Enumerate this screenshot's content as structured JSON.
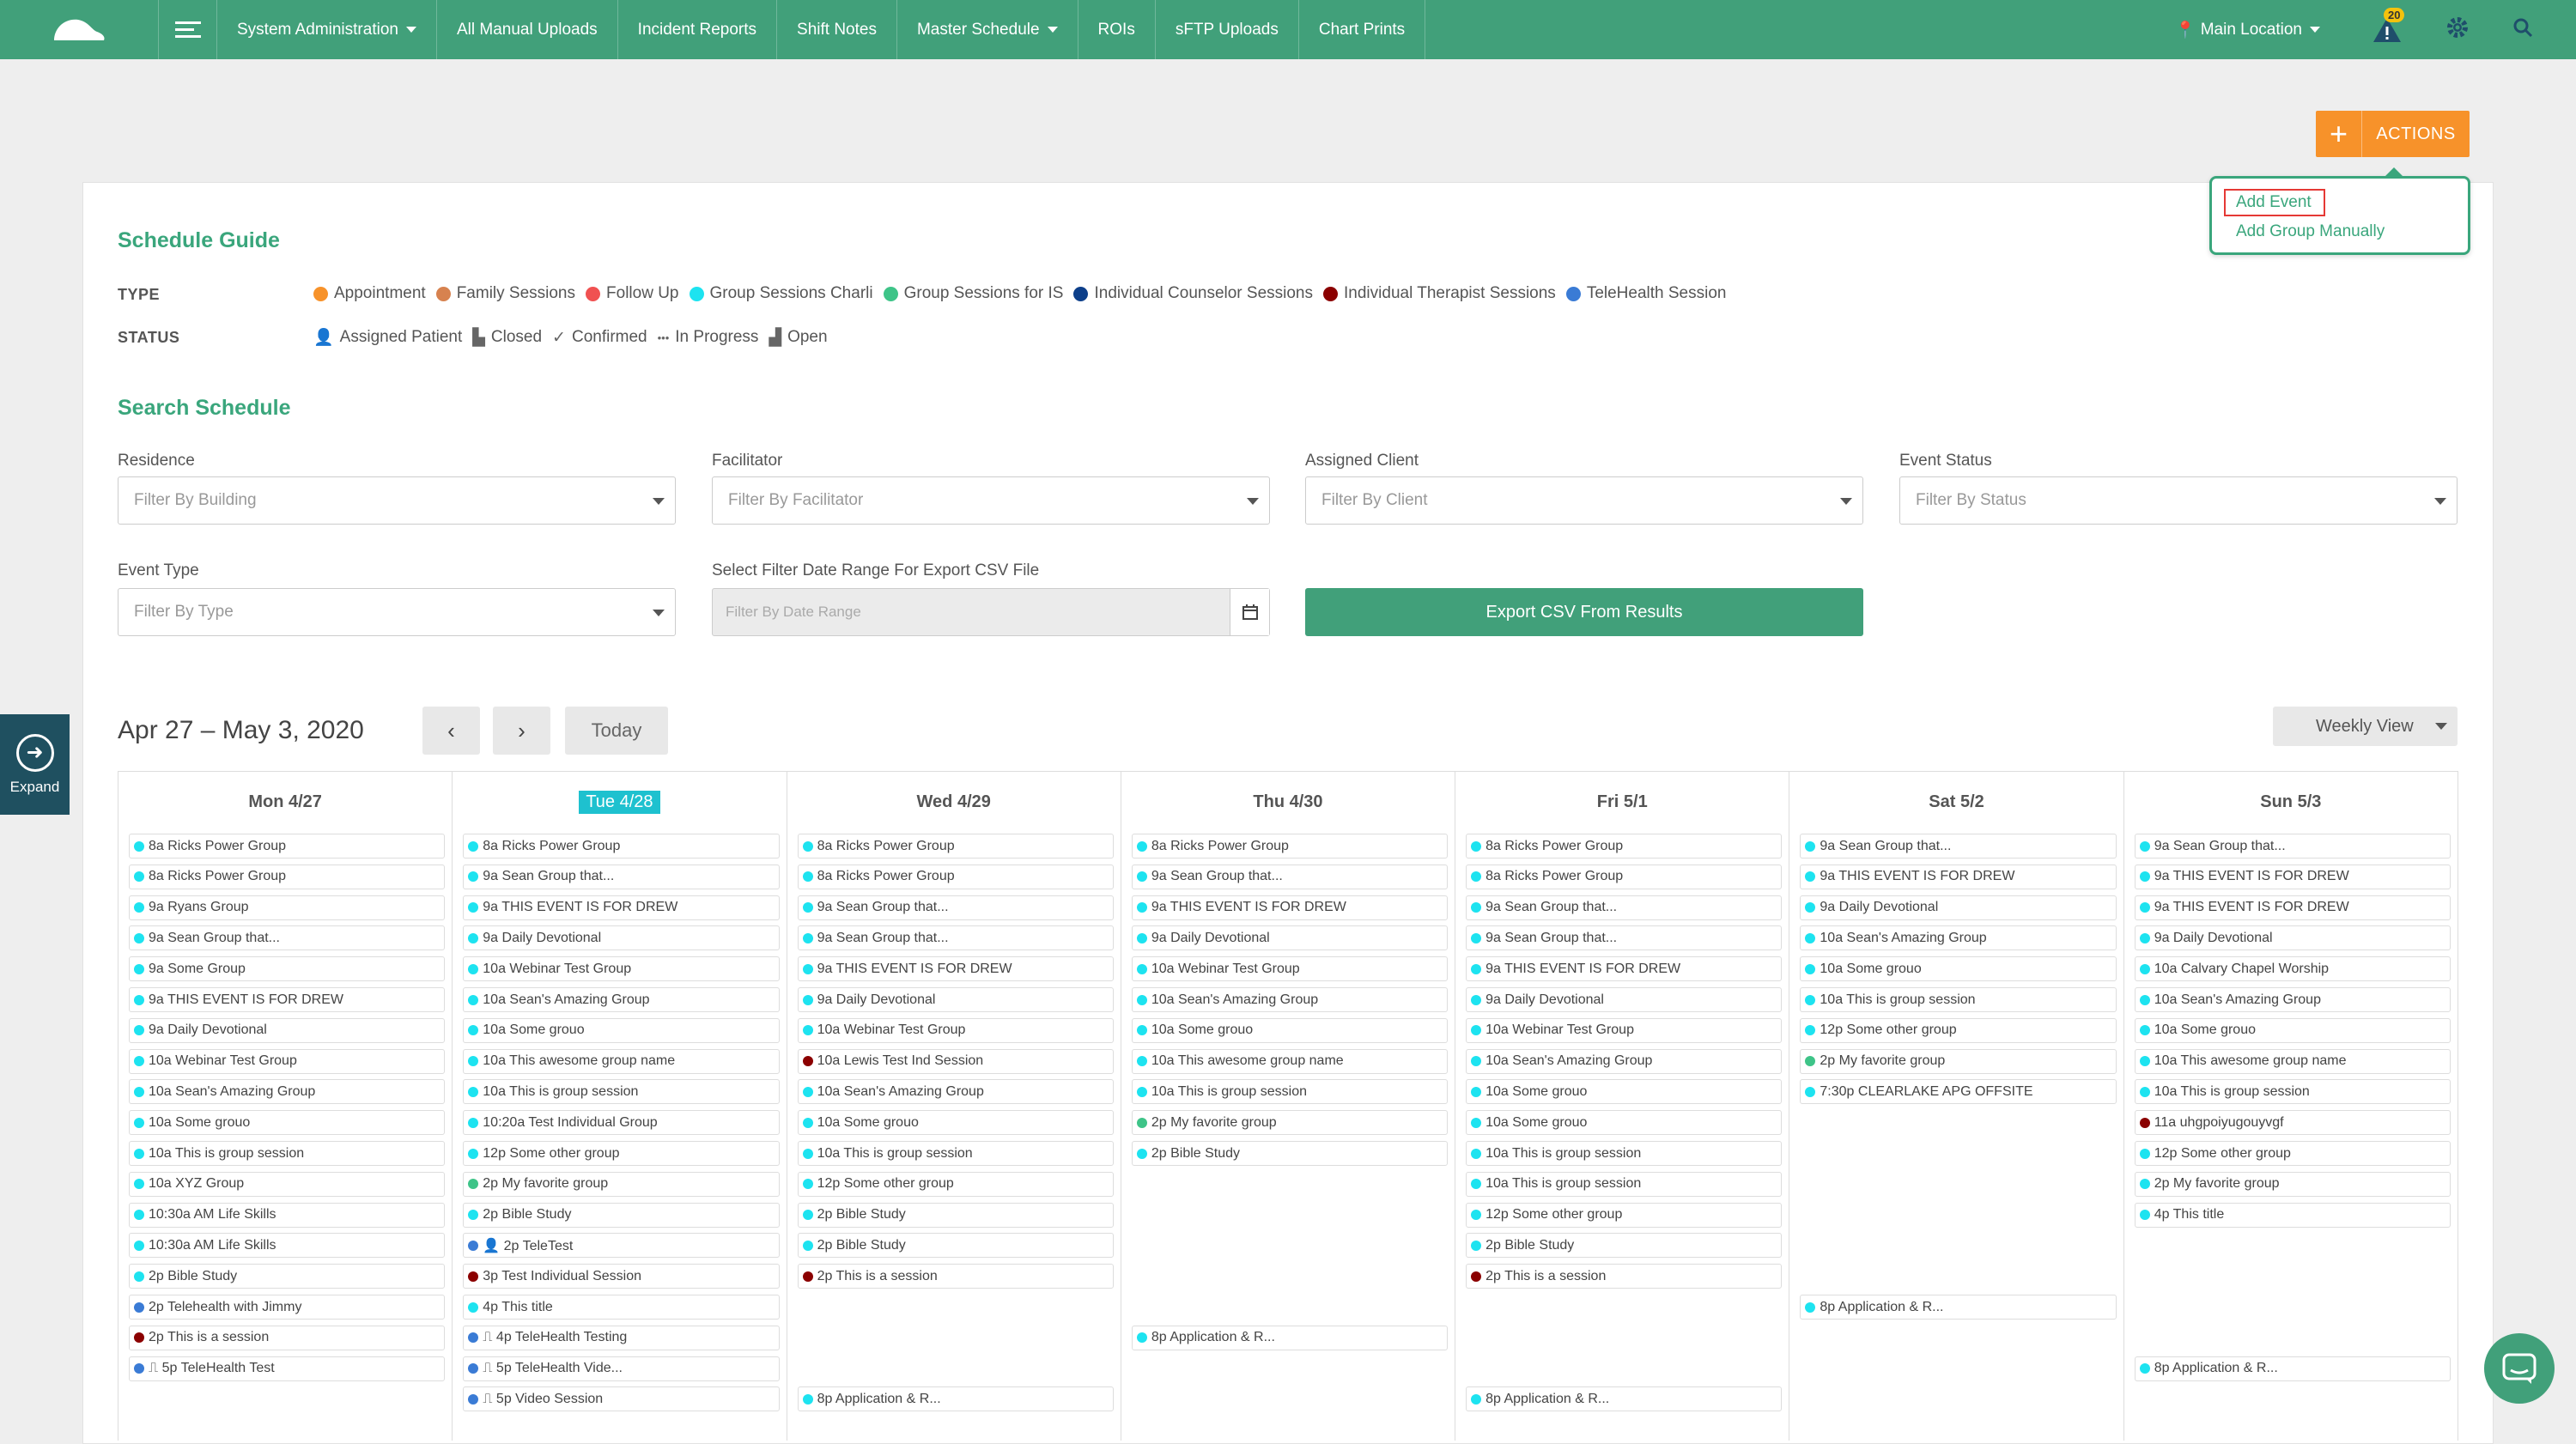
{
  "nav": {
    "items": [
      "System Administration",
      "All Manual Uploads",
      "Incident Reports",
      "Shift Notes",
      "Master Schedule",
      "ROIs",
      "sFTP Uploads",
      "Chart Prints"
    ],
    "dropdown_items": [
      0,
      4
    ],
    "location": "Main Location",
    "notification_count": "20"
  },
  "actions": {
    "label": "ACTIONS",
    "menu": [
      "Add Event",
      "Add Group Manually"
    ]
  },
  "guide": {
    "title": "Schedule Guide",
    "type_label": "TYPE",
    "status_label": "STATUS",
    "types": [
      {
        "name": "Appointment",
        "color": "#f7922a"
      },
      {
        "name": "Family Sessions",
        "color": "#d7824f"
      },
      {
        "name": "Follow Up",
        "color": "#f05151"
      },
      {
        "name": "Group Sessions Charli",
        "color": "#1de3f0"
      },
      {
        "name": "Group Sessions for IS",
        "color": "#3ec488"
      },
      {
        "name": "Individual Counselor Sessions",
        "color": "#0d3f8a"
      },
      {
        "name": "Individual Therapist Sessions",
        "color": "#8b0000"
      },
      {
        "name": "TeleHealth Session",
        "color": "#3a7bd5"
      }
    ],
    "statuses": [
      {
        "name": "Assigned Patient",
        "icon": "user-icon"
      },
      {
        "name": "Closed",
        "icon": "closed-icon"
      },
      {
        "name": "Confirmed",
        "icon": "check-icon"
      },
      {
        "name": "In Progress",
        "icon": "ellipsis-icon"
      },
      {
        "name": "Open",
        "icon": "open-icon"
      }
    ]
  },
  "search": {
    "title": "Search Schedule",
    "residence_label": "Residence",
    "residence_placeholder": "Filter By Building",
    "facilitator_label": "Facilitator",
    "facilitator_placeholder": "Filter By Facilitator",
    "client_label": "Assigned Client",
    "client_placeholder": "Filter By Client",
    "status_label": "Event Status",
    "status_placeholder": "Filter By Status",
    "type_label": "Event Type",
    "type_placeholder": "Filter By Type",
    "range_label": "Select Filter Date Range For Export CSV File",
    "range_placeholder": "Filter By Date Range",
    "export_label": "Export CSV From Results"
  },
  "calendar": {
    "range": "Apr 27 – May 3, 2020",
    "prev": "‹",
    "next": "›",
    "today": "Today",
    "view": "Weekly View",
    "expand": "Expand",
    "days": [
      {
        "label": "Mon 4/27",
        "today": false,
        "events": [
          {
            "t": "8a Ricks Power Group",
            "c": "#1de3f0"
          },
          {
            "t": "8a Ricks Power Group",
            "c": "#1de3f0"
          },
          {
            "t": "9a Ryans Group",
            "c": "#1de3f0"
          },
          {
            "t": "9a Sean Group that...",
            "c": "#1de3f0"
          },
          {
            "t": "9a Some Group",
            "c": "#1de3f0"
          },
          {
            "t": "9a THIS EVENT IS FOR DREW",
            "c": "#1de3f0"
          },
          {
            "t": "9a Daily Devotional",
            "c": "#1de3f0"
          },
          {
            "t": "10a Webinar Test Group",
            "c": "#1de3f0"
          },
          {
            "t": "10a Sean's Amazing Group",
            "c": "#1de3f0"
          },
          {
            "t": "10a Some grouo",
            "c": "#1de3f0"
          },
          {
            "t": "10a This is group session",
            "c": "#1de3f0"
          },
          {
            "t": "10a XYZ Group",
            "c": "#1de3f0"
          },
          {
            "t": "10:30a AM Life Skills",
            "c": "#1de3f0"
          },
          {
            "t": "10:30a AM Life Skills",
            "c": "#1de3f0"
          },
          {
            "t": "2p Bible Study",
            "c": "#1de3f0"
          },
          {
            "t": "2p Telehealth with Jimmy",
            "c": "#3a7bd5"
          },
          {
            "t": "2p This is a session",
            "c": "#8b0000"
          },
          {
            "t": "⎍ 5p TeleHealth Test",
            "c": "#3a7bd5"
          }
        ]
      },
      {
        "label": "Tue 4/28",
        "today": true,
        "events": [
          {
            "t": "8a Ricks Power Group",
            "c": "#1de3f0"
          },
          {
            "t": "9a Sean Group that...",
            "c": "#1de3f0"
          },
          {
            "t": "9a THIS EVENT IS FOR DREW",
            "c": "#1de3f0"
          },
          {
            "t": "9a Daily Devotional",
            "c": "#1de3f0"
          },
          {
            "t": "10a Webinar Test Group",
            "c": "#1de3f0"
          },
          {
            "t": "10a Sean's Amazing Group",
            "c": "#1de3f0"
          },
          {
            "t": "10a Some grouo",
            "c": "#1de3f0"
          },
          {
            "t": "10a This awesome group name",
            "c": "#1de3f0"
          },
          {
            "t": "10a This is group session",
            "c": "#1de3f0"
          },
          {
            "t": "10:20a Test Individual Group",
            "c": "#1de3f0"
          },
          {
            "t": "12p Some other group",
            "c": "#1de3f0"
          },
          {
            "t": "2p My favorite group",
            "c": "#3ec488"
          },
          {
            "t": "2p Bible Study",
            "c": "#1de3f0"
          },
          {
            "t": "👤 2p TeleTest",
            "c": "#3a7bd5"
          },
          {
            "t": "3p Test Individual Session",
            "c": "#8b0000"
          },
          {
            "t": "4p This title",
            "c": "#1de3f0"
          },
          {
            "t": "⎍ 4p TeleHealth Testing",
            "c": "#3a7bd5"
          },
          {
            "t": "⎍ 5p TeleHealth Vide...",
            "c": "#3a7bd5"
          },
          {
            "t": "⎍ 5p Video Session",
            "c": "#3a7bd5"
          }
        ]
      },
      {
        "label": "Wed 4/29",
        "today": false,
        "events": [
          {
            "t": "8a Ricks Power Group",
            "c": "#1de3f0"
          },
          {
            "t": "8a Ricks Power Group",
            "c": "#1de3f0"
          },
          {
            "t": "9a Sean Group that...",
            "c": "#1de3f0"
          },
          {
            "t": "9a Sean Group that...",
            "c": "#1de3f0"
          },
          {
            "t": "9a THIS EVENT IS FOR DREW",
            "c": "#1de3f0"
          },
          {
            "t": "9a Daily Devotional",
            "c": "#1de3f0"
          },
          {
            "t": "10a Webinar Test Group",
            "c": "#1de3f0"
          },
          {
            "t": "10a Lewis Test Ind Session",
            "c": "#8b0000"
          },
          {
            "t": "10a Sean's Amazing Group",
            "c": "#1de3f0"
          },
          {
            "t": "10a Some grouo",
            "c": "#1de3f0"
          },
          {
            "t": "10a This is group session",
            "c": "#1de3f0"
          },
          {
            "t": "12p Some other group",
            "c": "#1de3f0"
          },
          {
            "t": "2p Bible Study",
            "c": "#1de3f0"
          },
          {
            "t": "2p Bible Study",
            "c": "#1de3f0"
          },
          {
            "t": "2p This is a session",
            "c": "#8b0000"
          },
          {
            "t": "",
            "c": ""
          },
          {
            "t": "",
            "c": ""
          },
          {
            "t": "",
            "c": ""
          },
          {
            "t": "8p Application & R...",
            "c": "#1de3f0"
          }
        ]
      },
      {
        "label": "Thu 4/30",
        "today": false,
        "events": [
          {
            "t": "8a Ricks Power Group",
            "c": "#1de3f0"
          },
          {
            "t": "9a Sean Group that...",
            "c": "#1de3f0"
          },
          {
            "t": "9a THIS EVENT IS FOR DREW",
            "c": "#1de3f0"
          },
          {
            "t": "9a Daily Devotional",
            "c": "#1de3f0"
          },
          {
            "t": "10a Webinar Test Group",
            "c": "#1de3f0"
          },
          {
            "t": "10a Sean's Amazing Group",
            "c": "#1de3f0"
          },
          {
            "t": "10a Some grouo",
            "c": "#1de3f0"
          },
          {
            "t": "10a This awesome group name",
            "c": "#1de3f0"
          },
          {
            "t": "10a This is group session",
            "c": "#1de3f0"
          },
          {
            "t": "2p My favorite group",
            "c": "#3ec488"
          },
          {
            "t": "2p Bible Study",
            "c": "#1de3f0"
          },
          {
            "t": "",
            "c": ""
          },
          {
            "t": "",
            "c": ""
          },
          {
            "t": "",
            "c": ""
          },
          {
            "t": "",
            "c": ""
          },
          {
            "t": "",
            "c": ""
          },
          {
            "t": "8p Application & R...",
            "c": "#1de3f0"
          }
        ]
      },
      {
        "label": "Fri 5/1",
        "today": false,
        "events": [
          {
            "t": "8a Ricks Power Group",
            "c": "#1de3f0"
          },
          {
            "t": "8a Ricks Power Group",
            "c": "#1de3f0"
          },
          {
            "t": "9a Sean Group that...",
            "c": "#1de3f0"
          },
          {
            "t": "9a Sean Group that...",
            "c": "#1de3f0"
          },
          {
            "t": "9a THIS EVENT IS FOR DREW",
            "c": "#1de3f0"
          },
          {
            "t": "9a Daily Devotional",
            "c": "#1de3f0"
          },
          {
            "t": "10a Webinar Test Group",
            "c": "#1de3f0"
          },
          {
            "t": "10a Sean's Amazing Group",
            "c": "#1de3f0"
          },
          {
            "t": "10a Some grouo",
            "c": "#1de3f0"
          },
          {
            "t": "10a Some grouo",
            "c": "#1de3f0"
          },
          {
            "t": "10a This is group session",
            "c": "#1de3f0"
          },
          {
            "t": "10a This is group session",
            "c": "#1de3f0"
          },
          {
            "t": "12p Some other group",
            "c": "#1de3f0"
          },
          {
            "t": "2p Bible Study",
            "c": "#1de3f0"
          },
          {
            "t": "2p This is a session",
            "c": "#8b0000"
          },
          {
            "t": "",
            "c": ""
          },
          {
            "t": "",
            "c": ""
          },
          {
            "t": "",
            "c": ""
          },
          {
            "t": "8p Application & R...",
            "c": "#1de3f0"
          }
        ]
      },
      {
        "label": "Sat 5/2",
        "today": false,
        "events": [
          {
            "t": "9a Sean Group that...",
            "c": "#1de3f0"
          },
          {
            "t": "9a THIS EVENT IS FOR DREW",
            "c": "#1de3f0"
          },
          {
            "t": "9a Daily Devotional",
            "c": "#1de3f0"
          },
          {
            "t": "10a Sean's Amazing Group",
            "c": "#1de3f0"
          },
          {
            "t": "10a Some grouo",
            "c": "#1de3f0"
          },
          {
            "t": "10a This is group session",
            "c": "#1de3f0"
          },
          {
            "t": "12p Some other group",
            "c": "#1de3f0"
          },
          {
            "t": "2p My favorite group",
            "c": "#3ec488"
          },
          {
            "t": "7:30p CLEARLAKE APG OFFSITE",
            "c": "#1de3f0"
          },
          {
            "t": "",
            "c": ""
          },
          {
            "t": "",
            "c": ""
          },
          {
            "t": "",
            "c": ""
          },
          {
            "t": "",
            "c": ""
          },
          {
            "t": "",
            "c": ""
          },
          {
            "t": "",
            "c": ""
          },
          {
            "t": "8p Application & R...",
            "c": "#1de3f0"
          }
        ]
      },
      {
        "label": "Sun 5/3",
        "today": false,
        "events": [
          {
            "t": "9a Sean Group that...",
            "c": "#1de3f0"
          },
          {
            "t": "9a THIS EVENT IS FOR DREW",
            "c": "#1de3f0"
          },
          {
            "t": "9a THIS EVENT IS FOR DREW",
            "c": "#1de3f0"
          },
          {
            "t": "9a Daily Devotional",
            "c": "#1de3f0"
          },
          {
            "t": "10a Calvary Chapel Worship",
            "c": "#1de3f0"
          },
          {
            "t": "10a Sean's Amazing Group",
            "c": "#1de3f0"
          },
          {
            "t": "10a Some grouo",
            "c": "#1de3f0"
          },
          {
            "t": "10a This awesome group name",
            "c": "#1de3f0"
          },
          {
            "t": "10a This is group session",
            "c": "#1de3f0"
          },
          {
            "t": "11a uhgpoiyugouyvgf",
            "c": "#8b0000"
          },
          {
            "t": "12p Some other group",
            "c": "#1de3f0"
          },
          {
            "t": "2p My favorite group",
            "c": "#1de3f0"
          },
          {
            "t": "4p This title",
            "c": "#1de3f0"
          },
          {
            "t": "",
            "c": ""
          },
          {
            "t": "",
            "c": ""
          },
          {
            "t": "",
            "c": ""
          },
          {
            "t": "",
            "c": ""
          },
          {
            "t": "8p Application & R...",
            "c": "#1de3f0"
          }
        ]
      }
    ]
  }
}
